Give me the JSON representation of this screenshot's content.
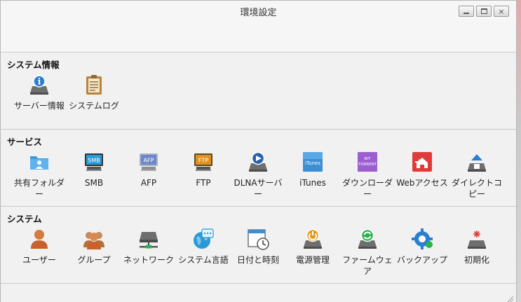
{
  "window": {
    "title": "環境設定",
    "buttons": {
      "minimize": "minimize-icon",
      "maximize": "maximize-icon",
      "close": "×"
    }
  },
  "sections": [
    {
      "title": "システム情報",
      "items": [
        {
          "label": "サーバー情報",
          "icon": "server-info-icon"
        },
        {
          "label": "システムログ",
          "icon": "system-log-icon"
        }
      ]
    },
    {
      "title": "サービス",
      "items": [
        {
          "label": "共有フォルダー",
          "icon": "shared-folder-icon"
        },
        {
          "label": "SMB",
          "icon": "smb-icon",
          "badge": "SMB"
        },
        {
          "label": "AFP",
          "icon": "afp-icon",
          "badge": "AFP"
        },
        {
          "label": "FTP",
          "icon": "ftp-icon",
          "badge": "FTP"
        },
        {
          "label": "DLNAサーバー",
          "icon": "dlna-icon"
        },
        {
          "label": "iTunes",
          "icon": "itunes-icon",
          "badge": "iTunes"
        },
        {
          "label": "ダウンローダー",
          "icon": "downloader-icon",
          "badge": "BIT TORRENT"
        },
        {
          "label": "Webアクセス",
          "icon": "web-access-icon"
        },
        {
          "label": "ダイレクトコピー",
          "icon": "direct-copy-icon"
        }
      ]
    },
    {
      "title": "システム",
      "items": [
        {
          "label": "ユーザー",
          "icon": "user-icon"
        },
        {
          "label": "グループ",
          "icon": "group-icon"
        },
        {
          "label": "ネットワーク",
          "icon": "network-icon"
        },
        {
          "label": "システム言語",
          "icon": "language-icon"
        },
        {
          "label": "日付と時刻",
          "icon": "date-time-icon"
        },
        {
          "label": "電源管理",
          "icon": "power-icon"
        },
        {
          "label": "ファームウェア",
          "icon": "firmware-icon"
        },
        {
          "label": "バックアップ",
          "icon": "backup-icon"
        },
        {
          "label": "初期化",
          "icon": "initialize-icon"
        }
      ]
    }
  ],
  "colors": {
    "window_bg": "#f1f1f1",
    "divider": "#c9c9c9",
    "icon_blue": "#2a8fd6",
    "icon_gray": "#6c6c6c",
    "icon_red": "#e03b3b",
    "icon_purple": "#9b59d0"
  }
}
